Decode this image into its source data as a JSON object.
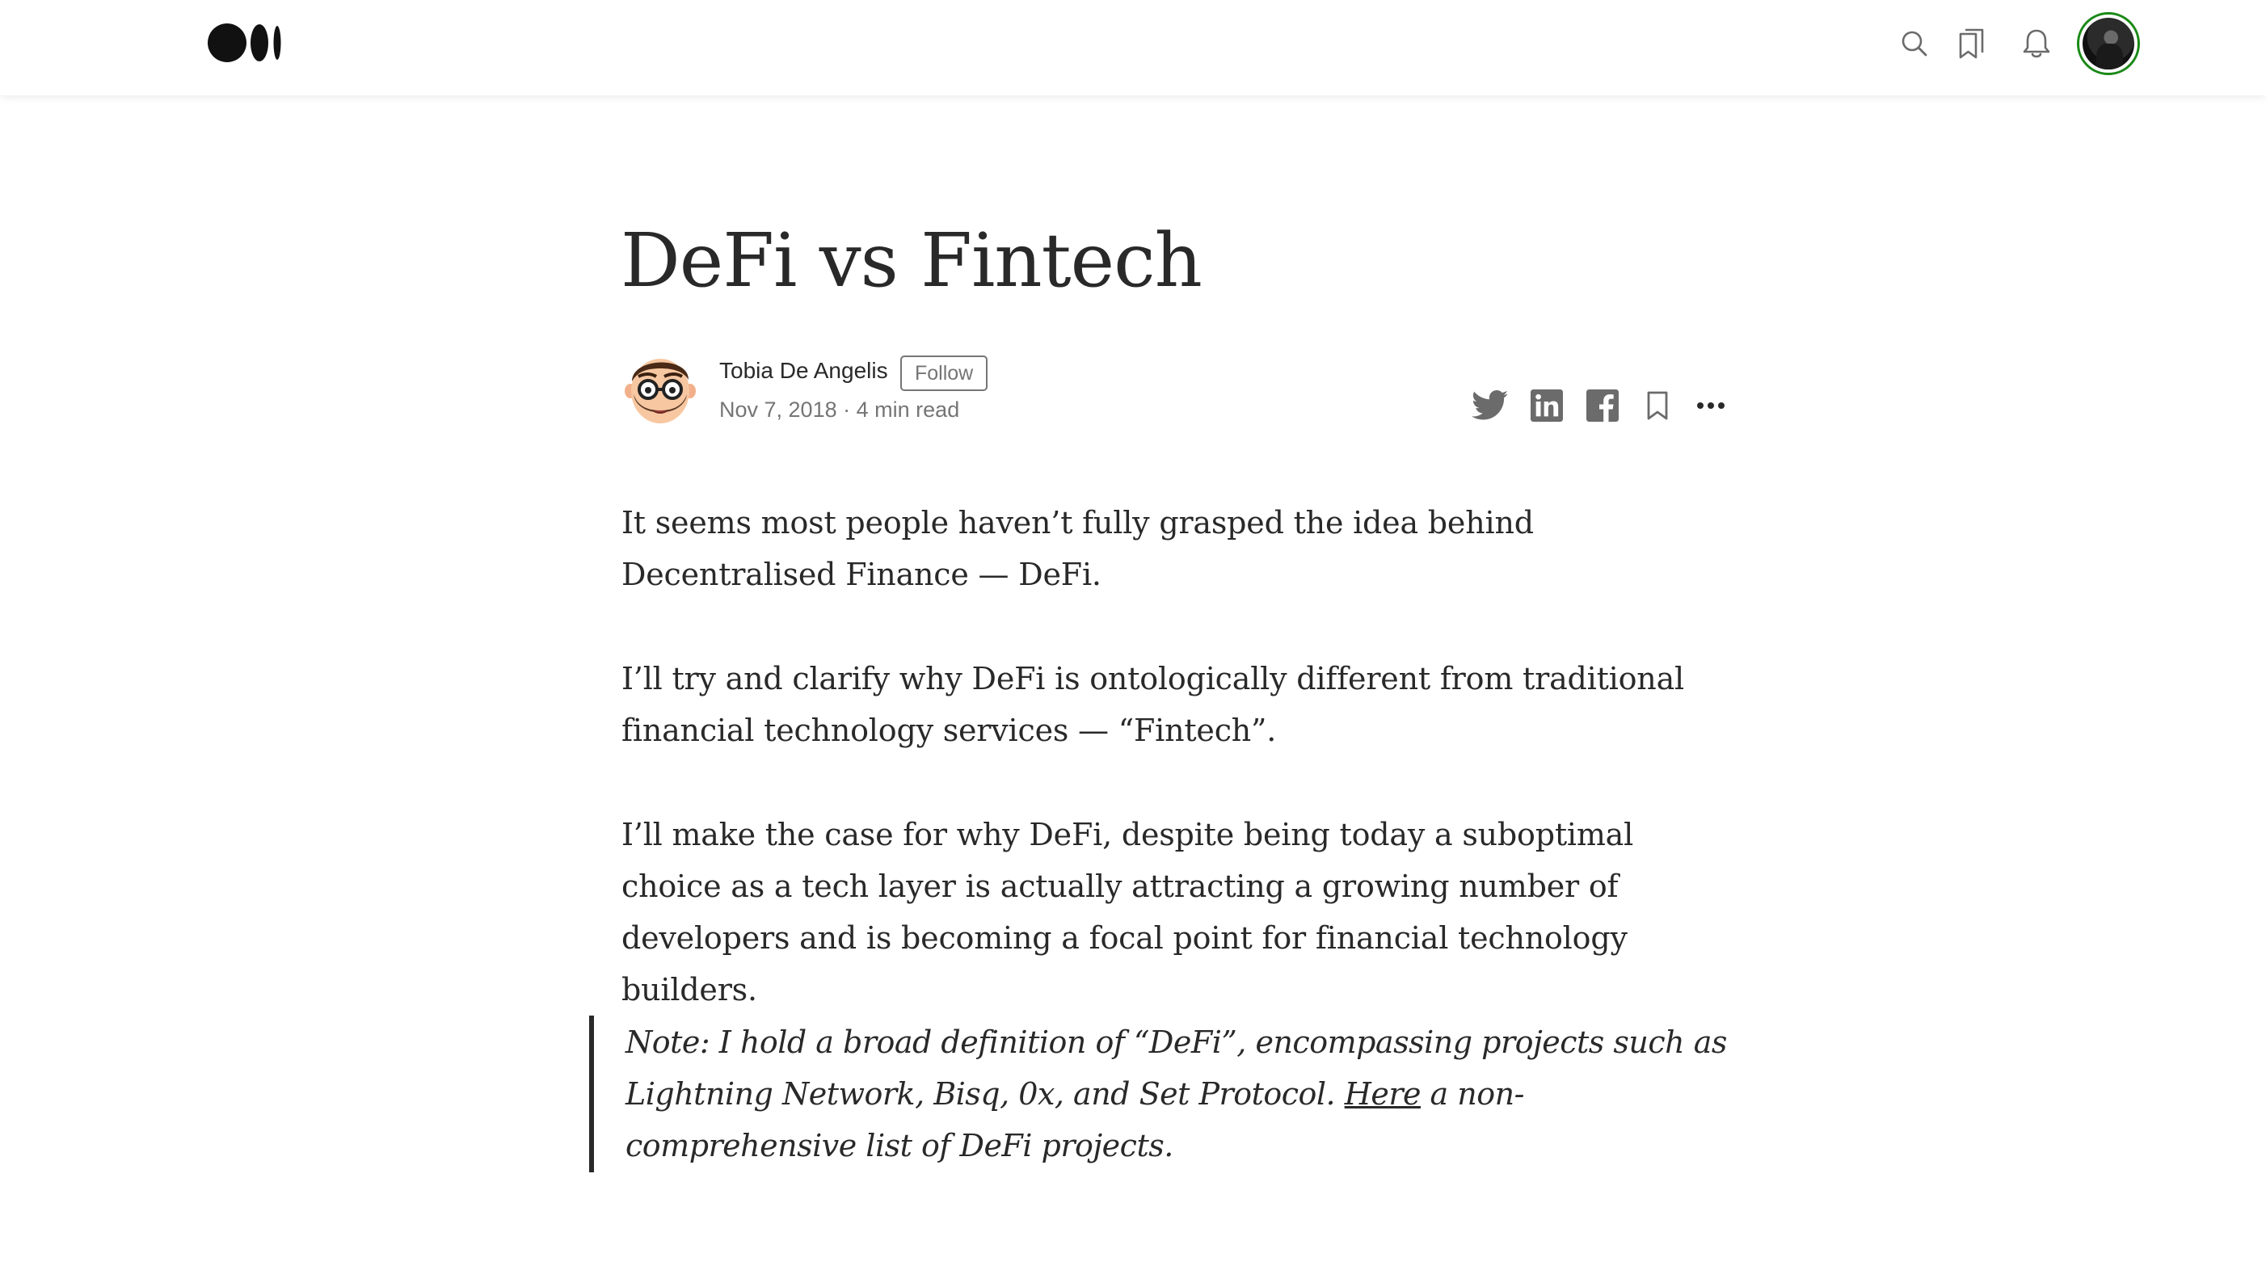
{
  "header": {
    "logo_name": "medium-logo",
    "icons": [
      "search-icon",
      "bookmarks-icon",
      "bell-icon"
    ],
    "user_avatar_ring_color": "#1a8917"
  },
  "article": {
    "title": "DeFi vs Fintech",
    "author": {
      "name": "Tobia De Angelis",
      "follow_label": "Follow",
      "date": "Nov 7, 2018",
      "separator": "·",
      "read_time": "4 min read"
    },
    "share_icons": [
      "twitter-icon",
      "linkedin-icon",
      "facebook-icon",
      "bookmark-icon",
      "more-icon"
    ],
    "paragraphs": [
      "It seems most people haven’t fully grasped the idea behind Decentralised Finance — DeFi.",
      "I’ll try and clarify why DeFi is ontologically different from traditional financial technology services — “Fintech”.",
      "I’ll make the case for why DeFi, despite being today a suboptimal choice as a tech layer is actually attracting a growing number of developers and is becoming a focal point for financial technology builders."
    ],
    "note": {
      "before_link": "Note: I hold a broad definition of “DeFi”, encompassing projects such as Lightning Network, Bisq, 0x, and Set Protocol. ",
      "link_text": "Here",
      "after_link": " a non-comprehensive list of DeFi projects."
    }
  },
  "colors": {
    "text": "#292929",
    "muted": "#757575",
    "accent_green": "#1a8917"
  }
}
